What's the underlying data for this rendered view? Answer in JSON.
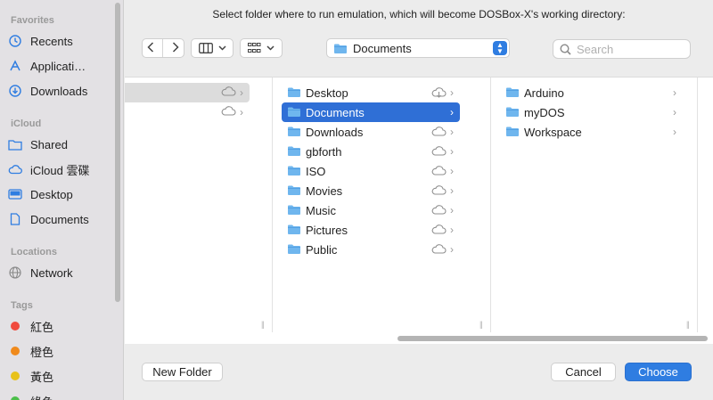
{
  "prompt": "Select folder where to run emulation, which will become DOSBox-X's working directory:",
  "sidebar": {
    "sections": {
      "favorites": "Favorites",
      "icloud": "iCloud",
      "locations": "Locations",
      "tags": "Tags"
    },
    "favorites": [
      {
        "label": "Recents",
        "icon": "clock-icon"
      },
      {
        "label": "Applicati…",
        "icon": "applications-icon"
      },
      {
        "label": "Downloads",
        "icon": "download-icon"
      }
    ],
    "icloud": [
      {
        "label": "Shared",
        "icon": "shared-folder-icon"
      },
      {
        "label": "iCloud 雲碟",
        "icon": "cloud-icon"
      },
      {
        "label": "Desktop",
        "icon": "desktop-icon"
      },
      {
        "label": "Documents",
        "icon": "document-icon"
      }
    ],
    "locations": [
      {
        "label": "Network",
        "icon": "network-icon"
      }
    ],
    "tags": [
      {
        "label": "紅色",
        "color": "#f04a3e"
      },
      {
        "label": "橙色",
        "color": "#f08a1c"
      },
      {
        "label": "黃色",
        "color": "#e8c21a"
      },
      {
        "label": "綠色",
        "color": "#4cbf4a"
      }
    ]
  },
  "toolbar": {
    "location": "Documents",
    "search_placeholder": "Search"
  },
  "column2": [
    {
      "label": "Desktop",
      "status": "download"
    },
    {
      "label": "Documents",
      "status": "selected"
    },
    {
      "label": "Downloads",
      "status": "cloud"
    },
    {
      "label": "gbforth",
      "status": "cloud"
    },
    {
      "label": "ISO",
      "status": "cloud"
    },
    {
      "label": "Movies",
      "status": "cloud"
    },
    {
      "label": "Music",
      "status": "cloud"
    },
    {
      "label": "Pictures",
      "status": "cloud"
    },
    {
      "label": "Public",
      "status": "cloud"
    }
  ],
  "column3": [
    {
      "label": "Arduino"
    },
    {
      "label": "myDOS"
    },
    {
      "label": "Workspace"
    }
  ],
  "buttons": {
    "new_folder": "New Folder",
    "cancel": "Cancel",
    "choose": "Choose"
  },
  "colors": {
    "accent": "#2f7de1",
    "selection": "#2f6fd6",
    "folder": "#6fb6ee"
  }
}
